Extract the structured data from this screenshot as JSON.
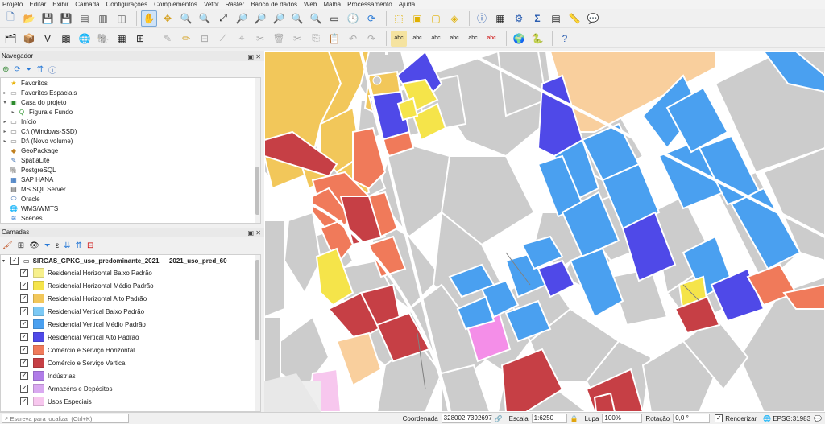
{
  "menu": [
    "Projeto",
    "Editar",
    "Exibir",
    "Camada",
    "Configurações",
    "Complementos",
    "Vetor",
    "Raster",
    "Banco de dados",
    "Web",
    "Malha",
    "Processamento",
    "Ajuda"
  ],
  "navigator": {
    "title": "Navegador",
    "items": [
      {
        "label": "Favoritos",
        "icon": "star-icon",
        "arrow": ""
      },
      {
        "label": "Favoritos Espaciais",
        "icon": "spatial-bookmark-icon",
        "arrow": "▸"
      },
      {
        "label": "Casa do projeto",
        "icon": "project-home-icon",
        "arrow": "▾"
      },
      {
        "label": "Figura e Fundo",
        "icon": "qgis-project-icon",
        "arrow": "▸",
        "indent": true
      },
      {
        "label": "Início",
        "icon": "folder-icon",
        "arrow": "▸"
      },
      {
        "label": "C:\\ (Windows-SSD)",
        "icon": "drive-icon",
        "arrow": "▸"
      },
      {
        "label": "D:\\ (Novo volume)",
        "icon": "drive-icon",
        "arrow": "▸"
      },
      {
        "label": "GeoPackage",
        "icon": "geopackage-icon",
        "arrow": ""
      },
      {
        "label": "SpatiaLite",
        "icon": "spatialite-icon",
        "arrow": ""
      },
      {
        "label": "PostgreSQL",
        "icon": "postgresql-icon",
        "arrow": ""
      },
      {
        "label": "SAP HANA",
        "icon": "sap-hana-icon",
        "arrow": ""
      },
      {
        "label": "MS SQL Server",
        "icon": "mssql-icon",
        "arrow": ""
      },
      {
        "label": "Oracle",
        "icon": "oracle-icon",
        "arrow": ""
      },
      {
        "label": "WMS/WMTS",
        "icon": "wms-icon",
        "arrow": ""
      },
      {
        "label": "Scenes",
        "icon": "scenes-icon",
        "arrow": ""
      }
    ]
  },
  "layers": {
    "title": "Camadas",
    "group": "SIRGAS_GPKG_uso_predominante_2021 — 2021_uso_pred_60",
    "items": [
      {
        "label": "Residencial Horizontal Baixo Padrão",
        "color": "#f7f08c"
      },
      {
        "label": "Residencial Horizontal Médio Padrão",
        "color": "#f5e44a"
      },
      {
        "label": "Residencial Horizontal Alto Padrão",
        "color": "#f2c75a"
      },
      {
        "label": "Residencial Vertical Baixo Padrão",
        "color": "#7cc9f5"
      },
      {
        "label": "Residencial Vertical Médio Padrão",
        "color": "#4aa0f0"
      },
      {
        "label": "Residencial Vertical Alto Padrão",
        "color": "#4f49e8"
      },
      {
        "label": "Comércio e Serviço Horizontal",
        "color": "#f07a5a"
      },
      {
        "label": "Comércio e Serviço Vertical",
        "color": "#c63f45"
      },
      {
        "label": "Indústrias",
        "color": "#b07ce8"
      },
      {
        "label": "Armazéns e Depósitos",
        "color": "#d9a9f0"
      },
      {
        "label": "Usos Especiais",
        "color": "#f7c7ee"
      }
    ]
  },
  "status": {
    "search_placeholder": "Escreva para localizar (Ctrl+K)",
    "coord_label": "Coordenada",
    "coord_value": "328002  7392697",
    "scale_label": "Escala",
    "scale_value": "1:6250",
    "zoom_label": "Lupa",
    "zoom_value": "100%",
    "rotation_label": "Rotação",
    "rotation_value": "0,0 °",
    "render_label": "Renderizar",
    "crs": "EPSG:31983"
  },
  "colors": {
    "block_gray": "#cccccc",
    "road": "#ffffff",
    "peach": "#f9cf9d"
  }
}
